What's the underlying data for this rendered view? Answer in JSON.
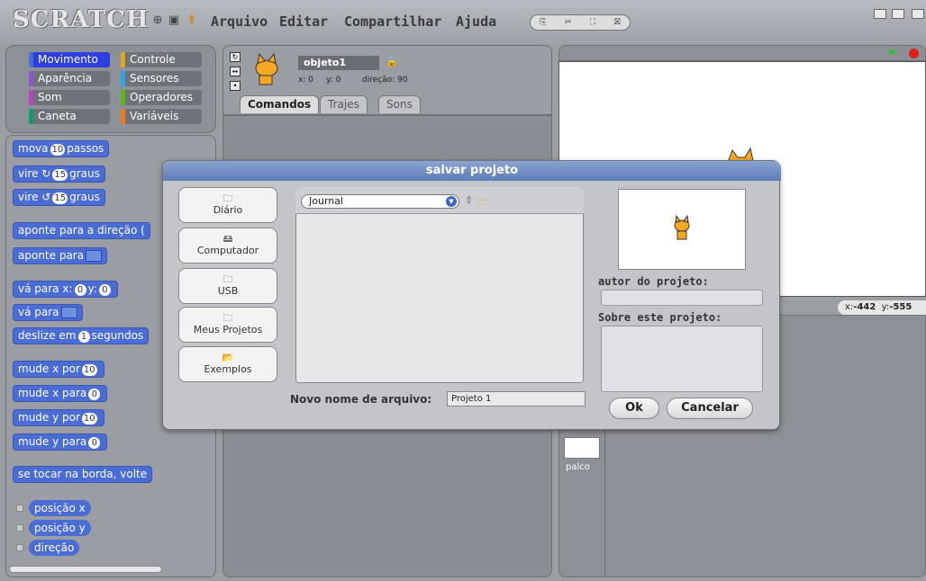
{
  "app": {
    "logo": "SCRATCH"
  },
  "menu": {
    "items": [
      "Arquivo",
      "Editar",
      "Compartilhar",
      "Ajuda"
    ]
  },
  "categories": [
    {
      "label": "Movimento",
      "color": "#4a6cd4",
      "selected": true
    },
    {
      "label": "Controle",
      "color": "#e1a91a"
    },
    {
      "label": "Aparência",
      "color": "#8a55d7"
    },
    {
      "label": "Sensores",
      "color": "#2ca5e2"
    },
    {
      "label": "Som",
      "color": "#bb42c3"
    },
    {
      "label": "Operadores",
      "color": "#5cb712"
    },
    {
      "label": "Caneta",
      "color": "#0e9a6c"
    },
    {
      "label": "Variáveis",
      "color": "#ee7d16"
    }
  ],
  "blocks": {
    "move_a": "mova",
    "move_n": "10",
    "move_b": "passos",
    "turn_r_a": "vire ↻",
    "turn_r_n": "15",
    "turn_r_b": "graus",
    "turn_l_a": "vire ↺",
    "turn_l_n": "15",
    "turn_l_b": "graus",
    "point_dir": "aponte para a direção (",
    "point_to": "aponte para",
    "goto_xy_a": "vá para x:",
    "goto_xy_x": "0",
    "goto_xy_b": "y:",
    "goto_xy_y": "0",
    "goto": "vá para",
    "glide_a": "deslize em",
    "glide_n": "1",
    "glide_b": "segundos",
    "chx_a": "mude x por",
    "chx_n": "10",
    "setx_a": "mude x para",
    "setx_n": "0",
    "chy_a": "mude y por",
    "chy_n": "10",
    "sety_a": "mude y para",
    "sety_n": "0",
    "bounce": "se tocar na borda, volte",
    "rep_x": "posição x",
    "rep_y": "posição y",
    "rep_dir": "direção"
  },
  "sprite": {
    "name": "objeto1",
    "x_label": "x: 0",
    "y_label": "y: 0",
    "dir_label": "direção: 90",
    "tabs": [
      "Comandos",
      "Trajes",
      "Sons"
    ]
  },
  "stage": {
    "x_label": "x:",
    "x": "-442",
    "y_label": "y:",
    "y": "-555",
    "palco": "palco"
  },
  "dialog": {
    "title": "salvar projeto",
    "locations": [
      "Diário",
      "Computador",
      "USB",
      "Meus Projetos",
      "Exemplos"
    ],
    "path": "Journal",
    "filename_label": "Novo nome de arquivo:",
    "filename": "Projeto 1",
    "author_label": "autor do projeto:",
    "about_label": "Sobre este projeto:",
    "ok": "Ok",
    "cancel": "Cancelar"
  }
}
